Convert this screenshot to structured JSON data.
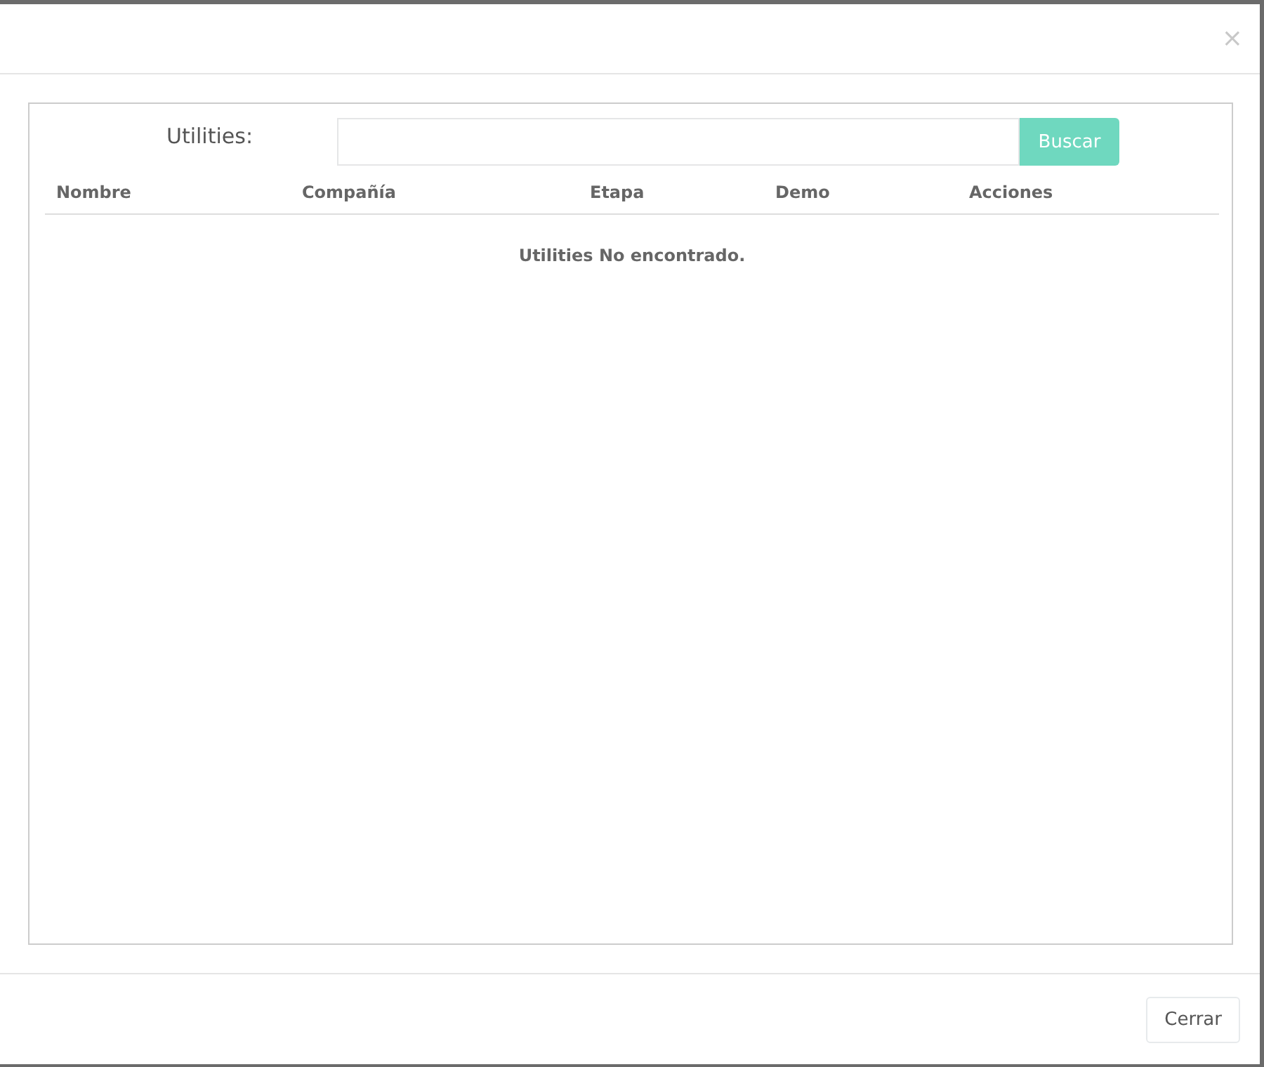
{
  "dialog": {
    "close_icon": "×"
  },
  "search": {
    "label": "Utilities:",
    "button": "Buscar"
  },
  "table": {
    "columns": [
      "Nombre",
      "Compañía",
      "Etapa",
      "Demo",
      "Acciones"
    ],
    "empty_message": "Utilities No encontrado."
  },
  "footer": {
    "buttons": [
      "Cerrar"
    ]
  }
}
